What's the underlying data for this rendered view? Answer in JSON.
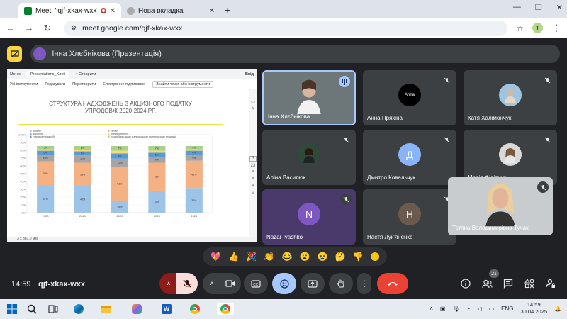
{
  "browser": {
    "tabs": [
      {
        "title": "Meet: \"qjf-xkax-wxx\"",
        "active": true
      },
      {
        "title": "Нова вкладка",
        "active": false
      }
    ],
    "new_tab": "+",
    "url": "meet.google.com/qjf-xkax-wxx",
    "profile_initial": "T"
  },
  "meet": {
    "presenter_banner": "Інна Хлєбнікова (Презентація)",
    "presenter_initial": "I",
    "clock": "14:59",
    "meeting_code": "qjf-xkax-wxx",
    "people_count": "21"
  },
  "shared_screen": {
    "top_bar": {
      "menu": "Меню",
      "tab": "Presentations_Хлєб",
      "create": "+ Створити",
      "view": "Вхід"
    },
    "toolbar": [
      "Усі інструменти",
      "Редагувати",
      "Перетворити",
      "Електронне підписання",
      "Знайти текст або інструменти"
    ],
    "page_numbers": [
      "3",
      "23"
    ],
    "status": "3 x 381.0 мм",
    "slide_title_1": "СТРУКТУРА НАДХОДЖЕНЬ З АКЦИЗНОГО ПОДАТКУ",
    "slide_title_2": "УПРОДОВЖ 2020-2024 РР.",
    "chart_data": {
      "type": "bar",
      "stacked": true,
      "categories": [
        "2020",
        "2021",
        "2022",
        "2023",
        "2024"
      ],
      "y_ticks": [
        "0%",
        "10%",
        "20%",
        "30%",
        "40%",
        "50%",
        "60%",
        "70%",
        "80%",
        "90%",
        "100%"
      ],
      "legend": [
        "пальне",
        "алкоголь",
        "транспортні засоби",
        "тютюн",
        "електроенергія",
        "роздрібний акциз з алкогольних та тютюнових продукції"
      ],
      "series": [
        {
          "name": "пальне",
          "color": "#9dc3e6",
          "values": [
            41,
            40,
            18,
            33,
            37
          ],
          "labels": [
            "41%",
            "40%",
            "18%",
            "33%",
            "37%"
          ]
        },
        {
          "name": "тютюн",
          "color": "#f4b183",
          "values": [
            36,
            35,
            51,
            42,
            41
          ],
          "labels": [
            "36%",
            "35%",
            "51%",
            "42%",
            "41%"
          ]
        },
        {
          "name": "алкоголь",
          "color": "#a5a5a5",
          "values": [
            10,
            11,
            12,
            9,
            9
          ],
          "labels": [
            "10%",
            "11%",
            "12%",
            "9%",
            "9%"
          ]
        },
        {
          "name": "транспортні засоби",
          "color": "#5b9bd5",
          "values": [
            6,
            6,
            8,
            6,
            6
          ],
          "labels": [
            "6%",
            "6%",
            "8%",
            "6%",
            "6%"
          ]
        },
        {
          "name": "електроенергія",
          "color": "#ffd966",
          "values": [
            2,
            2,
            4,
            3,
            2
          ],
          "labels": [
            "",
            "",
            "",
            "",
            ""
          ]
        },
        {
          "name": "роздрібний акциз з алкогольних та тютюнових продукції",
          "color": "#a9d18e",
          "values": [
            5,
            6,
            7,
            7,
            5
          ],
          "labels": [
            "5%",
            "6%",
            "7%",
            "7%",
            "5%"
          ]
        }
      ]
    }
  },
  "participants": [
    {
      "name": "Інна Хлєбнікова",
      "type": "video",
      "speaking": true
    },
    {
      "name": "Анна Пряхіна",
      "type": "logo",
      "logo_text": "Anna"
    },
    {
      "name": "Катя Халімончук",
      "type": "photo"
    },
    {
      "name": "Аліна Василюк",
      "type": "photo"
    },
    {
      "name": "Дмитро Ковальчук",
      "type": "initial",
      "initial": "Д"
    },
    {
      "name": "Марія Філіпчук",
      "type": "photo"
    },
    {
      "name": "Nazar Ivashko",
      "type": "initial",
      "initial": "N"
    },
    {
      "name": "Настя Лук'яненко",
      "type": "initial",
      "initial": "Н"
    },
    {
      "name": "Тетяна Володимирівна Тучак",
      "type": "video"
    }
  ],
  "reactions": [
    "💖",
    "👍",
    "🎉",
    "👏",
    "😂",
    "😮",
    "😢",
    "🤔",
    "👎"
  ],
  "taskbar": {
    "language": "ENG",
    "time": "14:59",
    "date": "30.04.2025"
  },
  "colors": {
    "meet_bg": "#202124",
    "end_call": "#ea4335",
    "mic_muted": "#f9dedc",
    "presenting_btn": "#a8c7fa"
  }
}
